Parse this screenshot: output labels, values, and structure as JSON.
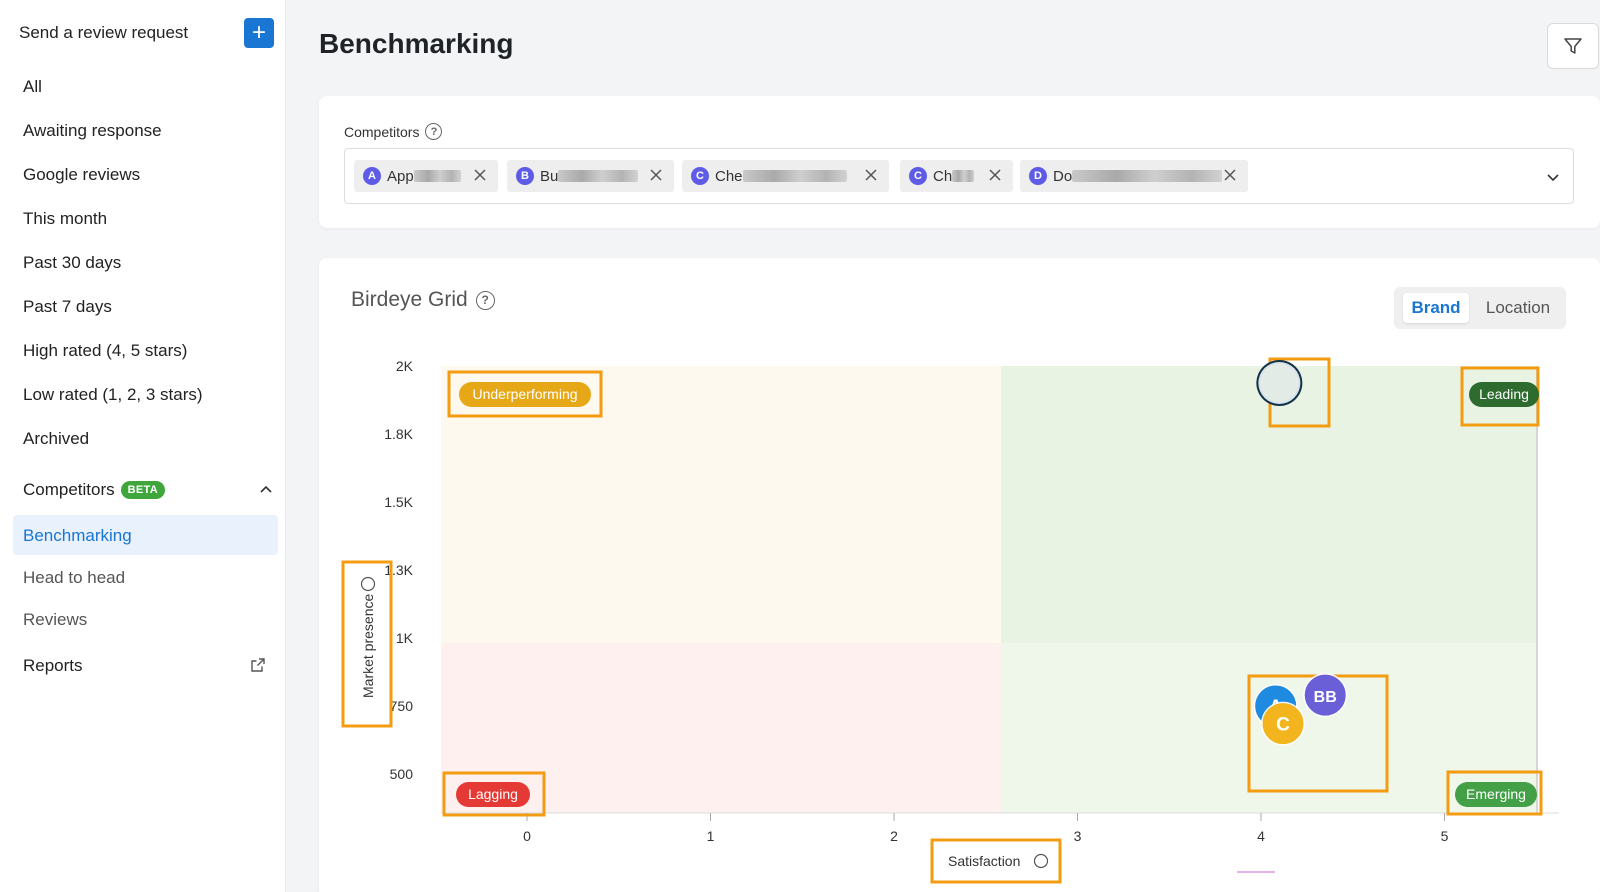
{
  "sidebar": {
    "send_label": "Send a review request",
    "plus": "+",
    "items": [
      {
        "label": "All"
      },
      {
        "label": "Awaiting response"
      },
      {
        "label": "Google reviews"
      },
      {
        "label": "This month"
      },
      {
        "label": "Past 30 days"
      },
      {
        "label": "Past 7 days"
      },
      {
        "label": "High rated (4, 5 stars)"
      },
      {
        "label": "Low rated (1, 2, 3 stars)"
      },
      {
        "label": "Archived"
      }
    ],
    "competitors": {
      "label": "Competitors",
      "badge": "BETA"
    },
    "sub_items": [
      {
        "label": "Benchmarking",
        "active": true
      },
      {
        "label": "Head to head"
      },
      {
        "label": "Reviews"
      }
    ],
    "reports": "Reports"
  },
  "header": {
    "title": "Benchmarking"
  },
  "competitors": {
    "label": "Competitors",
    "chips": [
      {
        "avatar": "A",
        "text": "App"
      },
      {
        "avatar": "B",
        "text": "Bu"
      },
      {
        "avatar": "C",
        "text": "Che"
      },
      {
        "avatar": "C",
        "text": "Ch"
      },
      {
        "avatar": "D",
        "text": "Do"
      }
    ]
  },
  "grid": {
    "title": "Birdeye Grid",
    "toggle": {
      "active": "Brand",
      "inactive": "Location"
    }
  },
  "colors": {
    "accent": "#1976d2",
    "underperforming": "#e6a817",
    "leading": "#2e6b2e",
    "lagging": "#e53935",
    "emerging": "#43a047",
    "highlight": "#f39c12"
  },
  "chart_data": {
    "type": "scatter",
    "xlabel": "Satisfaction",
    "ylabel": "Market presence",
    "x_ticks": [
      "0",
      "1",
      "2",
      "3",
      "4",
      "5"
    ],
    "y_ticks": [
      "2K",
      "1.8K",
      "1.5K",
      "1.3K",
      "1K",
      "750",
      "500"
    ],
    "quadrants": {
      "top_left": "Underperforming",
      "top_right": "Leading",
      "bottom_left": "Lagging",
      "bottom_right": "Emerging"
    },
    "points": [
      {
        "label": "",
        "x": 4.1,
        "y": 1950,
        "color": "#d9e3e8"
      },
      {
        "label": "BB",
        "x": 4.35,
        "y": 790,
        "color": "#6b5fd8"
      },
      {
        "label": "A",
        "x": 4.08,
        "y": 750,
        "color": "#1e8be0"
      },
      {
        "label": "C",
        "x": 4.12,
        "y": 685,
        "color": "#f2b51d"
      }
    ]
  }
}
